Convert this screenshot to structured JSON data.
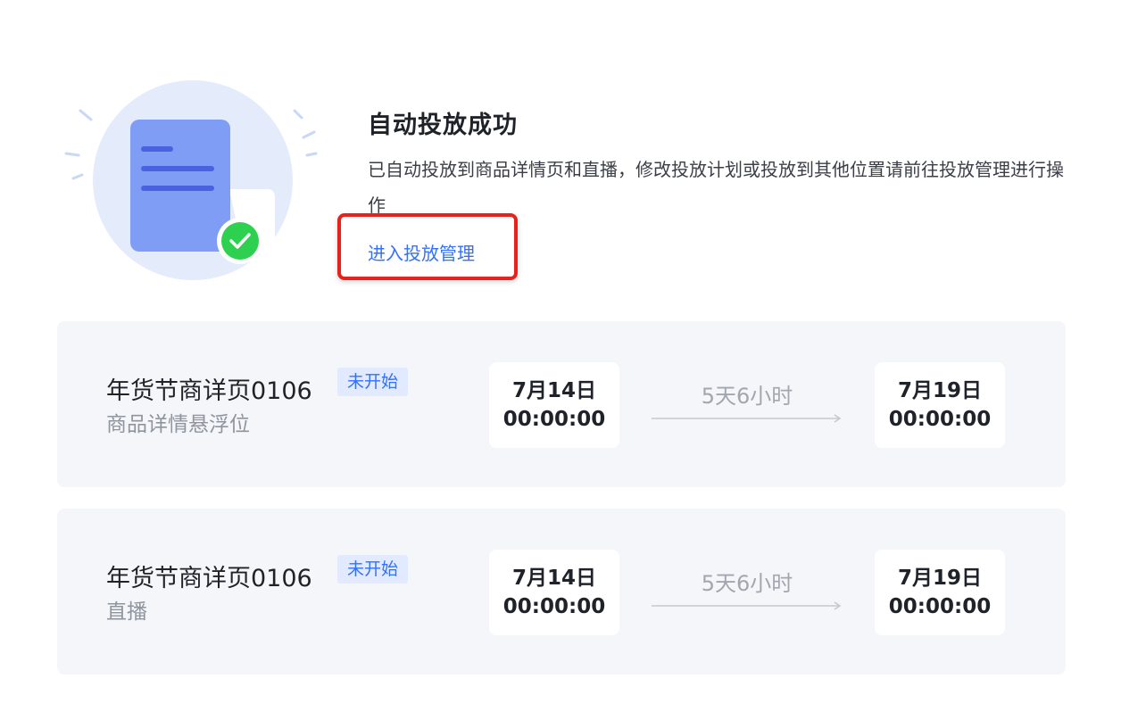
{
  "success": {
    "title": "自动投放成功",
    "description": "已自动投放到商品详情页和直播，修改投放计划或投放到其他位置请前往投放管理进行操作",
    "link_label": "进入投放管理"
  },
  "cards": [
    {
      "name": "年货节商详页0106",
      "status": "未开始",
      "position": "商品详情悬浮位",
      "start_date": "7月14日",
      "start_time": "00:00:00",
      "duration": "5天6小时",
      "end_date": "7月19日",
      "end_time": "00:00:00"
    },
    {
      "name": "年货节商详页0106",
      "status": "未开始",
      "position": "直播",
      "start_date": "7月14日",
      "start_time": "00:00:00",
      "duration": "5天6小时",
      "end_date": "7月19日",
      "end_time": "00:00:00"
    }
  ],
  "colors": {
    "accent": "#3370ff",
    "highlight": "#e8211c",
    "success": "#2ed14f",
    "card_bg": "#f4f6f9",
    "badge_bg": "#e1eaff"
  },
  "icons": {
    "illustration": "document-success-illustration",
    "check": "check-circle-icon",
    "arrow": "arrow-right-icon"
  }
}
